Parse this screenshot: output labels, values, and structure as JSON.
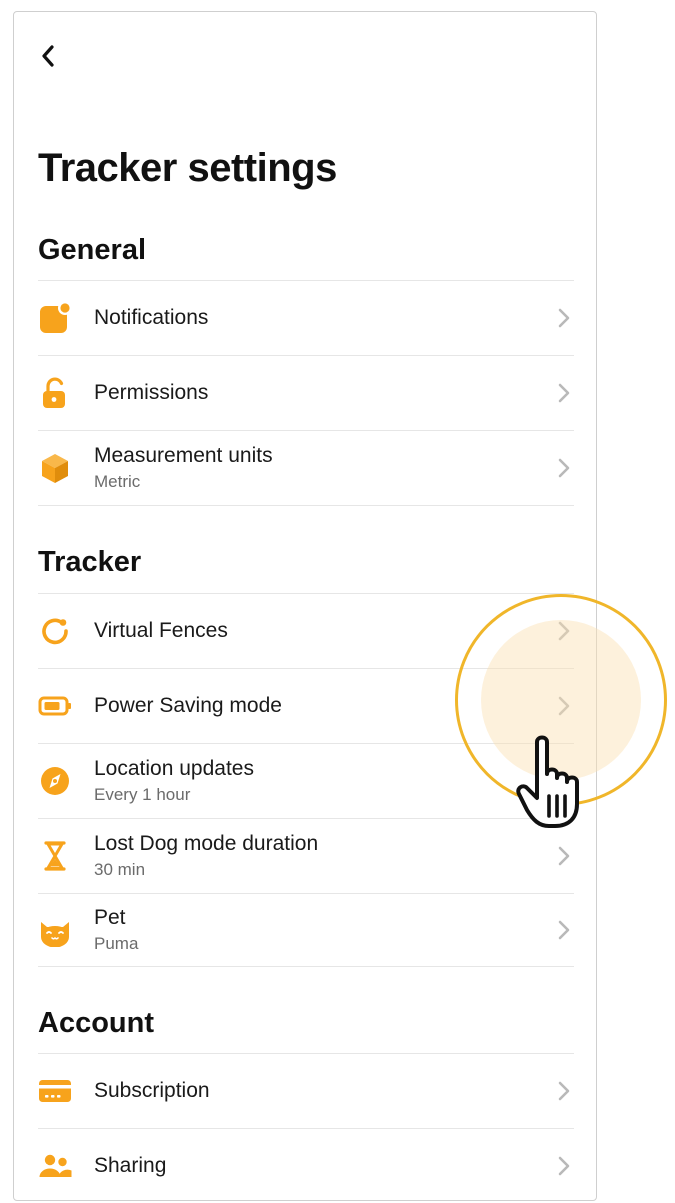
{
  "header": {
    "back_icon": "chevron-left-icon",
    "title": "Tracker settings"
  },
  "accent_color": "#f7a31c",
  "sections": [
    {
      "title": "General",
      "items": [
        {
          "label": "Notifications",
          "sub": "",
          "icon": "notification-badge-icon"
        },
        {
          "label": "Permissions",
          "sub": "",
          "icon": "unlocked-padlock-icon"
        },
        {
          "label": "Measurement units",
          "sub": "Metric",
          "icon": "cube-icon"
        }
      ]
    },
    {
      "title": "Tracker",
      "items": [
        {
          "label": "Virtual Fences",
          "sub": "",
          "icon": "fence-circle-icon"
        },
        {
          "label": "Power Saving mode",
          "sub": "",
          "icon": "battery-icon"
        },
        {
          "label": "Location updates",
          "sub": "Every 1 hour",
          "icon": "compass-icon"
        },
        {
          "label": "Lost Dog mode duration",
          "sub": "30 min",
          "icon": "hourglass-icon"
        },
        {
          "label": "Pet",
          "sub": "Puma",
          "icon": "cat-face-icon"
        }
      ]
    },
    {
      "title": "Account",
      "items": [
        {
          "label": "Subscription",
          "sub": "",
          "icon": "credit-card-icon"
        },
        {
          "label": "Sharing",
          "sub": "",
          "icon": "people-icon"
        }
      ]
    }
  ],
  "overlay": {
    "icon": "pointer-hand-icon",
    "highlight_color": "#f0b62a"
  }
}
